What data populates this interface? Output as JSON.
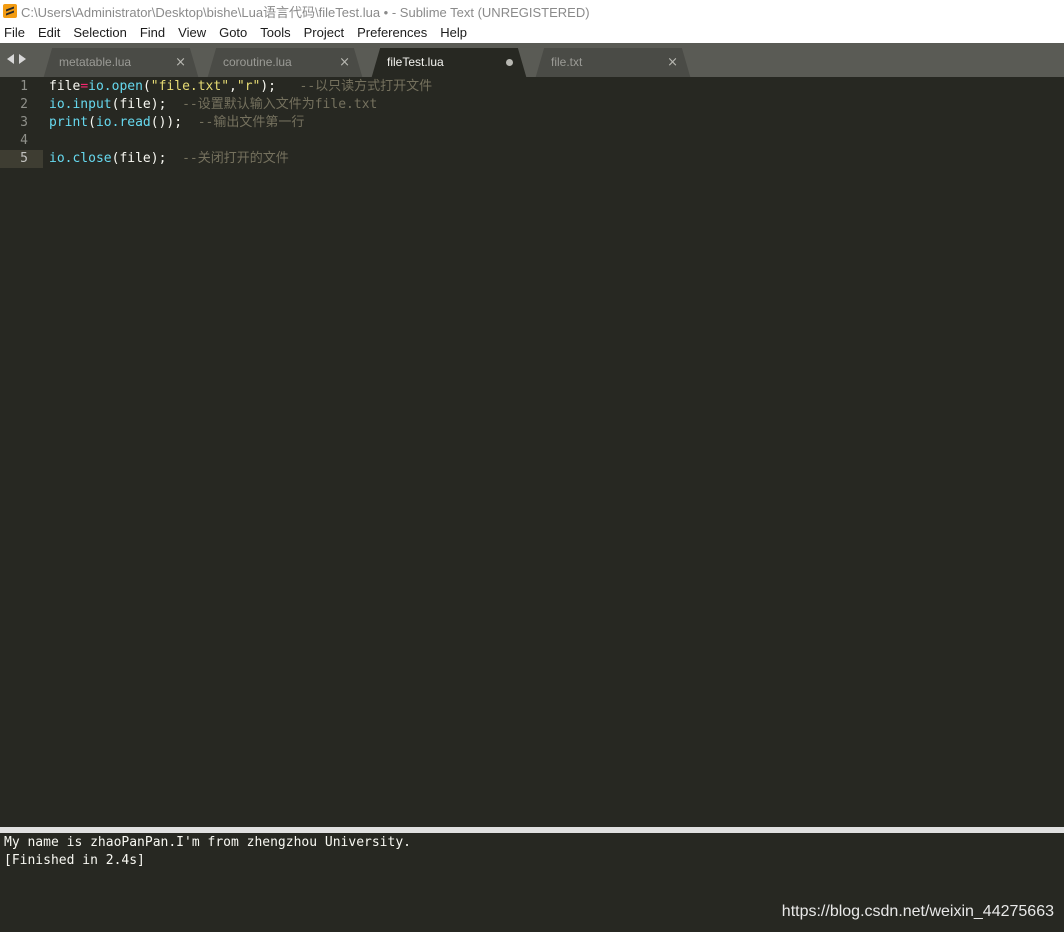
{
  "window": {
    "title": "C:\\Users\\Administrator\\Desktop\\bishe\\Lua语言代码\\fileTest.lua • - Sublime Text (UNREGISTERED)",
    "icon": "sublime-text-icon"
  },
  "menu": [
    "File",
    "Edit",
    "Selection",
    "Find",
    "View",
    "Goto",
    "Tools",
    "Project",
    "Preferences",
    "Help"
  ],
  "tabs": [
    {
      "label": "metatable.lua",
      "close": "×"
    },
    {
      "label": "coroutine.lua",
      "close": "×"
    },
    {
      "label": "fileTest.lua",
      "modified": "●"
    },
    {
      "label": "file.txt",
      "close": "×"
    }
  ],
  "editor": {
    "lines": [
      {
        "num": "1",
        "tokens": [
          "file",
          "=",
          "io.open",
          "(",
          "\"file.txt\"",
          ",",
          "\"r\"",
          ");   ",
          "--以只读方式打开文件"
        ]
      },
      {
        "num": "2",
        "tokens": [
          "io.input",
          "(file);  ",
          "--设置默认输入文件为file.txt"
        ]
      },
      {
        "num": "3",
        "tokens": [
          "print",
          "(",
          "io.read",
          "());  ",
          "--输出文件第一行"
        ]
      },
      {
        "num": "4",
        "tokens": []
      },
      {
        "num": "5",
        "tokens": [
          "io.close",
          "(file);  ",
          "--关闭打开的文件"
        ]
      }
    ]
  },
  "output": {
    "lines": [
      "My name is zhaoPanPan.I'm from zhengzhou University.",
      "[Finished in 2.4s]"
    ]
  },
  "watermark": "https://blog.csdn.net/weixin_44275663",
  "colors": {
    "background": "#272822",
    "keyword": "#f92672",
    "function": "#66d9ef",
    "string": "#e6db74",
    "comment": "#75715e"
  }
}
